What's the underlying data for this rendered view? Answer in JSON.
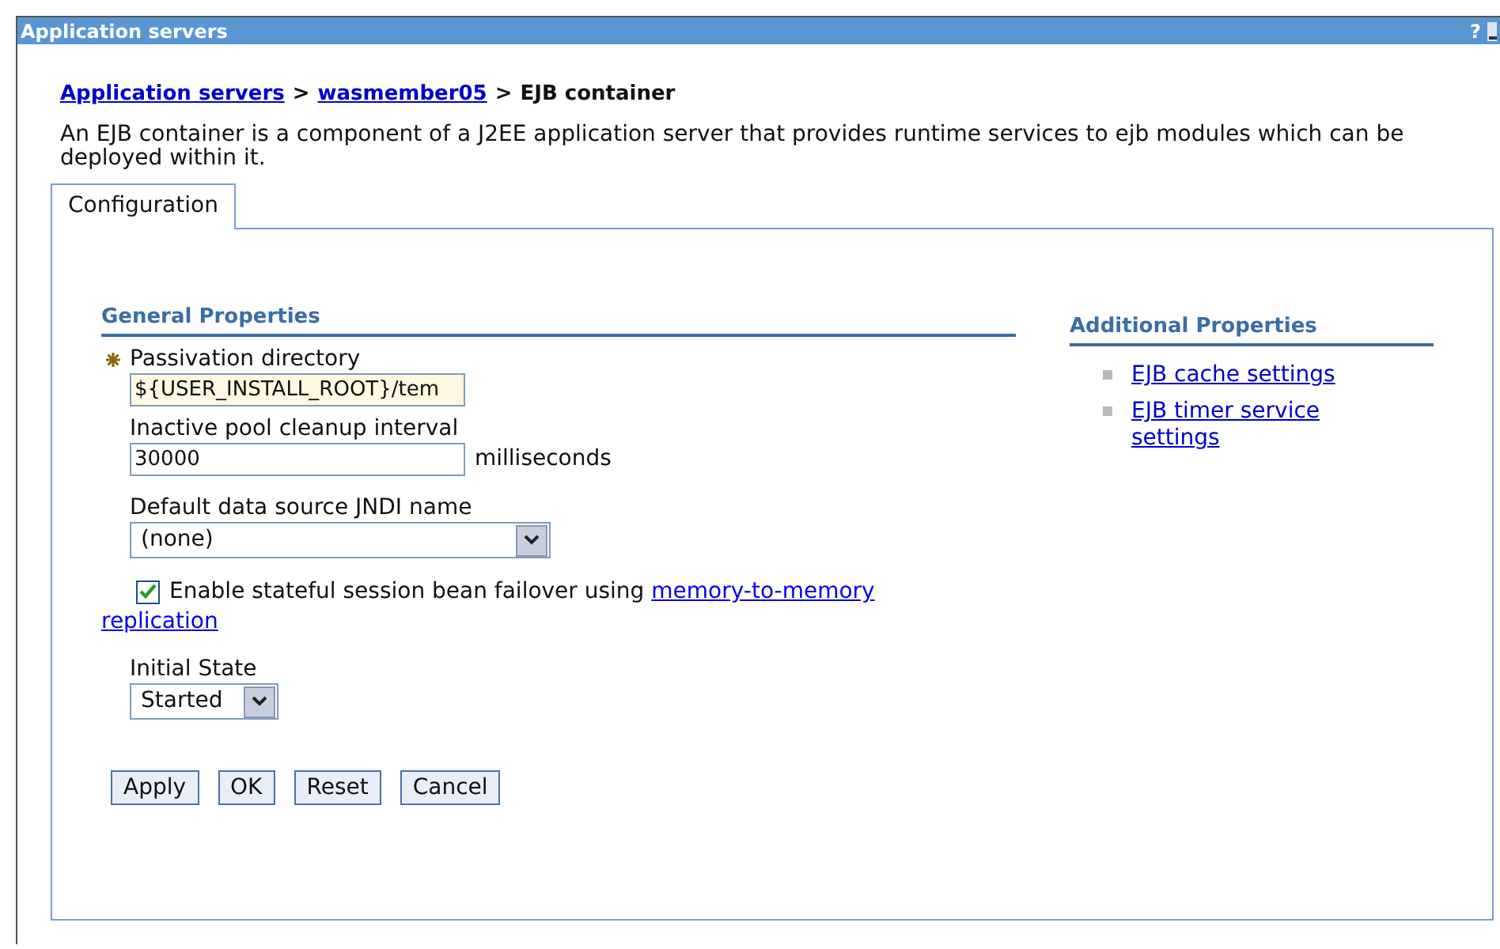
{
  "window": {
    "title": "Application servers",
    "help": "?"
  },
  "breadcrumb": [
    {
      "label": "Application servers",
      "link": true
    },
    {
      "label": "wasmember05",
      "link": true
    },
    {
      "label": "EJB container",
      "link": false
    }
  ],
  "breadcrumb_separator": ">",
  "description": "An EJB container is a component of a J2EE application server that provides runtime services to ejb modules which can be deployed within it.",
  "tabs": [
    {
      "label": "Configuration",
      "selected": true
    }
  ],
  "general_properties": {
    "title": "General Properties",
    "fields": [
      {
        "kind": "text",
        "label": "Passivation directory",
        "required": true,
        "value": "${USER_INSTALL_ROOT}/tem",
        "highlighted": true
      },
      {
        "kind": "text",
        "label": "Inactive pool cleanup interval",
        "required": false,
        "value": "30000",
        "unit": "milliseconds",
        "highlighted": false
      },
      {
        "kind": "select",
        "label": "Default data source JNDI name",
        "value": "(none)",
        "wide": true
      },
      {
        "kind": "checkbox",
        "checked": true,
        "label": "Enable stateful session bean failover using ",
        "link_lines": [
          "memory-to-memory",
          "replication"
        ]
      },
      {
        "kind": "select",
        "label": "Initial State",
        "value": "Started",
        "wide": false
      }
    ]
  },
  "buttons": [
    "Apply",
    "OK",
    "Reset",
    "Cancel"
  ],
  "additional_properties": {
    "title": "Additional Properties",
    "links": [
      "EJB cache settings",
      "EJB timer service settings"
    ]
  }
}
